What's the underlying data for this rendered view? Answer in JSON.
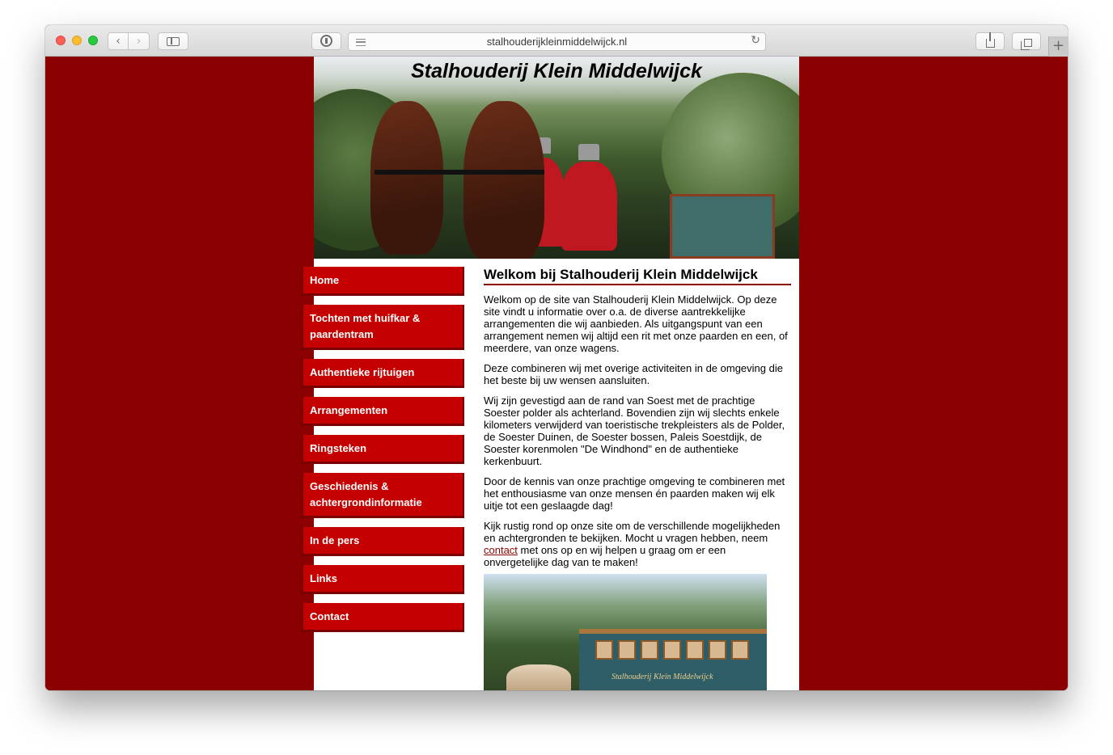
{
  "browser": {
    "url": "stalhouderijkleinmiddelwijck.nl",
    "back_glyph": "‹",
    "forward_glyph": "›",
    "reload_glyph": "↻",
    "newtab_glyph": "+"
  },
  "site": {
    "title": "Stalhouderij Klein Middelwijck",
    "background_color": "#8b0000",
    "nav_color": "#c40000"
  },
  "nav": {
    "items": [
      {
        "label": "Home"
      },
      {
        "label": "Tochten met huifkar & paardentram"
      },
      {
        "label": "Authentieke rijtuigen"
      },
      {
        "label": "Arrangementen"
      },
      {
        "label": "Ringsteken"
      },
      {
        "label": "Geschiedenis & achtergrondinformatie"
      },
      {
        "label": "In de pers"
      },
      {
        "label": "Links"
      },
      {
        "label": "Contact"
      }
    ]
  },
  "content": {
    "heading": "Welkom bij Stalhouderij Klein Middelwijck",
    "p1": "Welkom op de site van Stalhouderij Klein Middelwijck. Op deze site vindt u informatie over o.a. de diverse aantrekkelijke arrangementen die wij aanbieden. Als uitgangspunt van een arrangement nemen wij altijd een rit met onze paarden en een, of meerdere, van onze wagens.",
    "p2": "Deze combineren wij met overige activiteiten in de omgeving die het beste bij uw wensen aansluiten.",
    "p3": "Wij zijn gevestigd aan de rand van Soest met de prachtige Soester polder als achterland. Bovendien zijn wij slechts enkele kilometers verwijderd van toeristische trekpleisters als de Polder, de Soester Duinen, de Soester bossen, Paleis Soestdijk, de Soester korenmolen \"De Windhond\" en de authentieke kerkenbuurt.",
    "p4": "Door de kennis van onze prachtige omgeving te combineren met het enthousiasme van onze mensen én paarden maken wij elk uitje tot een geslaagde dag!",
    "p5_before": "Kijk rustig rond op onze site om de verschillende mogelijkheden en achtergronden te bekijken. Mocht u vragen hebben, neem ",
    "p5_link": "contact",
    "p5_after": " met ons op en wij helpen u graag om er een onvergetelijke dag van te maken!"
  },
  "photo": {
    "tram_label": "Stalhouderij Klein Middelwijck"
  }
}
